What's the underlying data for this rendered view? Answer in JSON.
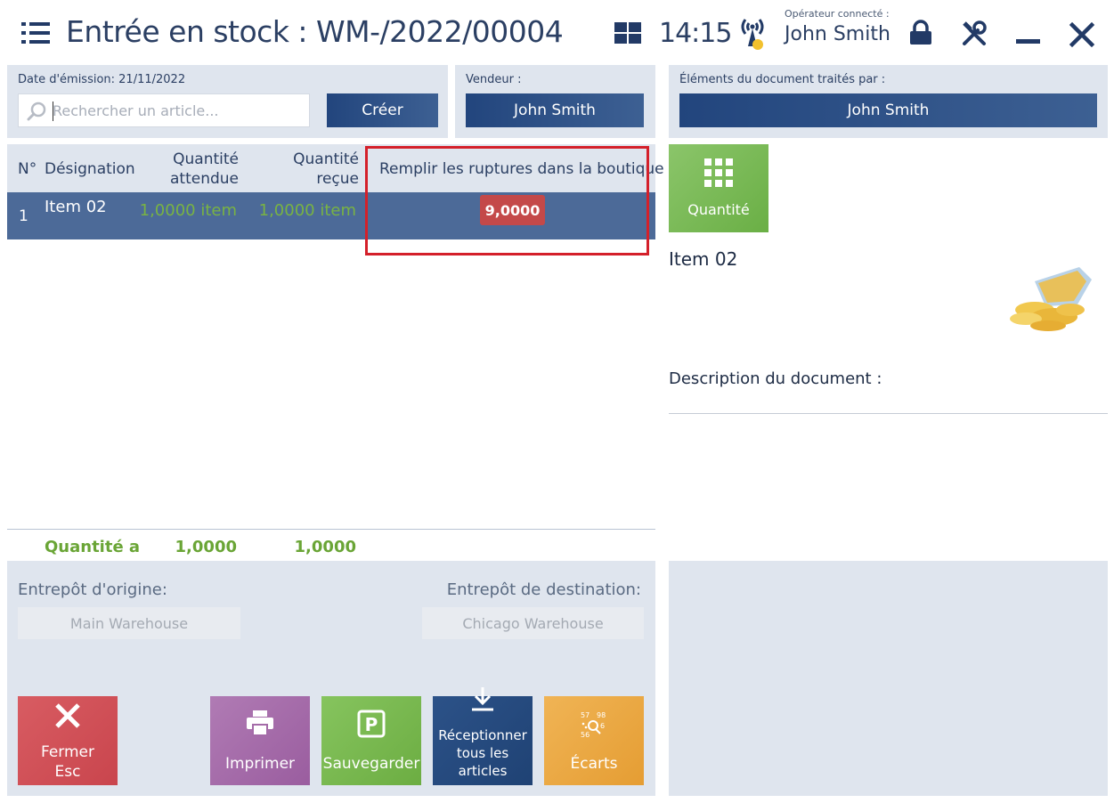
{
  "header": {
    "title": "Entrée en stock : WM-/2022/00004",
    "time": "14:15",
    "operator_label": "Opérateur connecté :",
    "operator_name": "John Smith"
  },
  "document": {
    "issue_date_label": "Date d'émission: 21/11/2022",
    "search_placeholder": "Rechercher un article...",
    "create_button": "Créer",
    "seller_label": "Vendeur :",
    "seller_name": "John Smith",
    "processed_by_label": "Éléments du document traités par :",
    "processed_by_name": "John Smith"
  },
  "table": {
    "headers": {
      "number": "N°",
      "designation": "Désignation",
      "expected_line1": "Quantité",
      "expected_line2": "attendue",
      "received_line1": "Quantité",
      "received_line2": "reçue",
      "refill": "Remplir les ruptures dans la boutique"
    },
    "rows": [
      {
        "number": "1",
        "designation": "Item 02",
        "expected": "1,0000 item",
        "received": "1,0000 item",
        "refill": "9,0000"
      }
    ],
    "footer": {
      "label": "Quantité a",
      "expected_total": "1,0000",
      "received_total": "1,0000"
    }
  },
  "warehouses": {
    "origin_label": "Entrepôt d'origine:",
    "origin_value": "Main Warehouse",
    "destination_label": "Entrepôt de destination:",
    "destination_value": "Chicago Warehouse"
  },
  "actions": {
    "close_line1": "Fermer",
    "close_line2": "Esc",
    "print": "Imprimer",
    "save": "Sauvegarder",
    "receive_line1": "Réceptionner",
    "receive_line2": "tous les articles",
    "discrepancies": "Écarts"
  },
  "details": {
    "quantity_tile": "Quantité",
    "item_name": "Item 02",
    "description_label": "Description du document :"
  },
  "colors": {
    "navy": "#22457d",
    "selected_row": "#4c6a98",
    "green_text": "#6aa536",
    "close_red": "#d3525a",
    "print_purple": "#a46ba8",
    "save_green": "#78b84f",
    "receive_navy": "#274b7e",
    "discrepancy_orange": "#eba843",
    "highlight_red": "#d4202a"
  }
}
